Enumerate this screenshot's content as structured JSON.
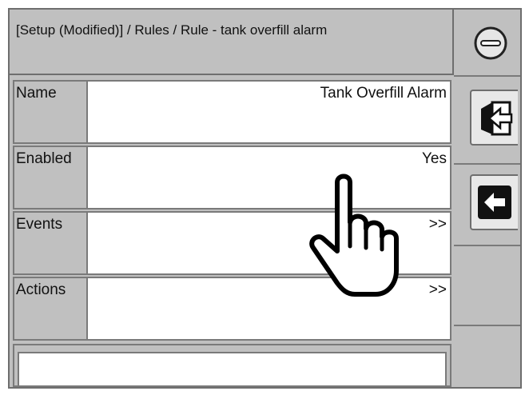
{
  "header": {
    "title": "[Setup (Modified)] / Rules / Rule - tank overfill alarm"
  },
  "rows": [
    {
      "label": "Name",
      "value": "Tank Overfill Alarm"
    },
    {
      "label": "Enabled",
      "value": "Yes"
    },
    {
      "label": "Events",
      "value": ">>"
    },
    {
      "label": "Actions",
      "value": ">>"
    }
  ],
  "side": {
    "buttons": [
      {
        "icon": "minus-circle-icon"
      },
      {
        "icon": "exit-door-icon"
      },
      {
        "icon": "back-arrow-icon"
      }
    ]
  },
  "overlay": {
    "icon": "pointing-hand-icon"
  }
}
